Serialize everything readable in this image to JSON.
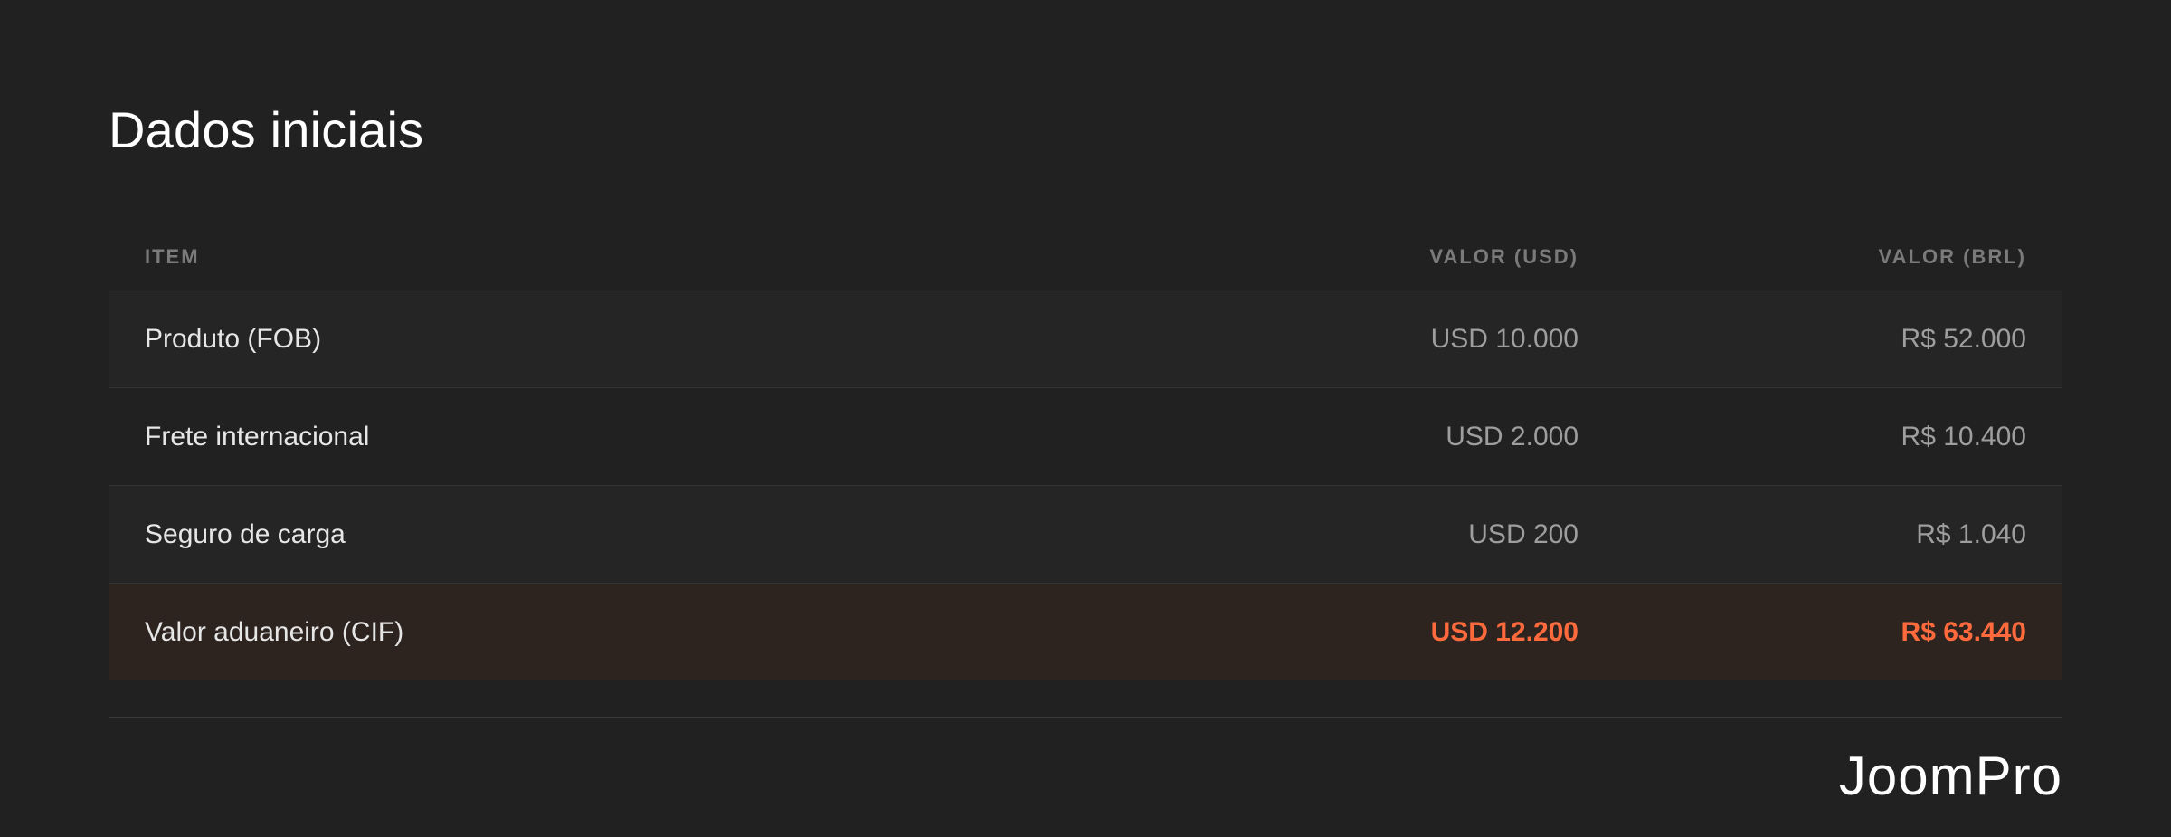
{
  "title": "Dados iniciais",
  "table": {
    "headers": [
      "ITEM",
      "VALOR (USD)",
      "VALOR (BRL)"
    ],
    "rows": [
      {
        "item": "Produto (FOB)",
        "usd": "USD 10.000",
        "brl": "R$ 52.000"
      },
      {
        "item": "Frete internacional",
        "usd": "USD 2.000",
        "brl": "R$ 10.400"
      },
      {
        "item": "Seguro de carga",
        "usd": "USD 200",
        "brl": "R$ 1.040"
      },
      {
        "item": "Valor aduaneiro (CIF)",
        "usd": "USD 12.200",
        "brl": "R$ 63.440"
      }
    ]
  },
  "brand": {
    "logo_text": "JoomPro"
  },
  "colors": {
    "background": "#212121",
    "accent": "#ff6a3d",
    "total_row_bg": "#2d2420"
  }
}
